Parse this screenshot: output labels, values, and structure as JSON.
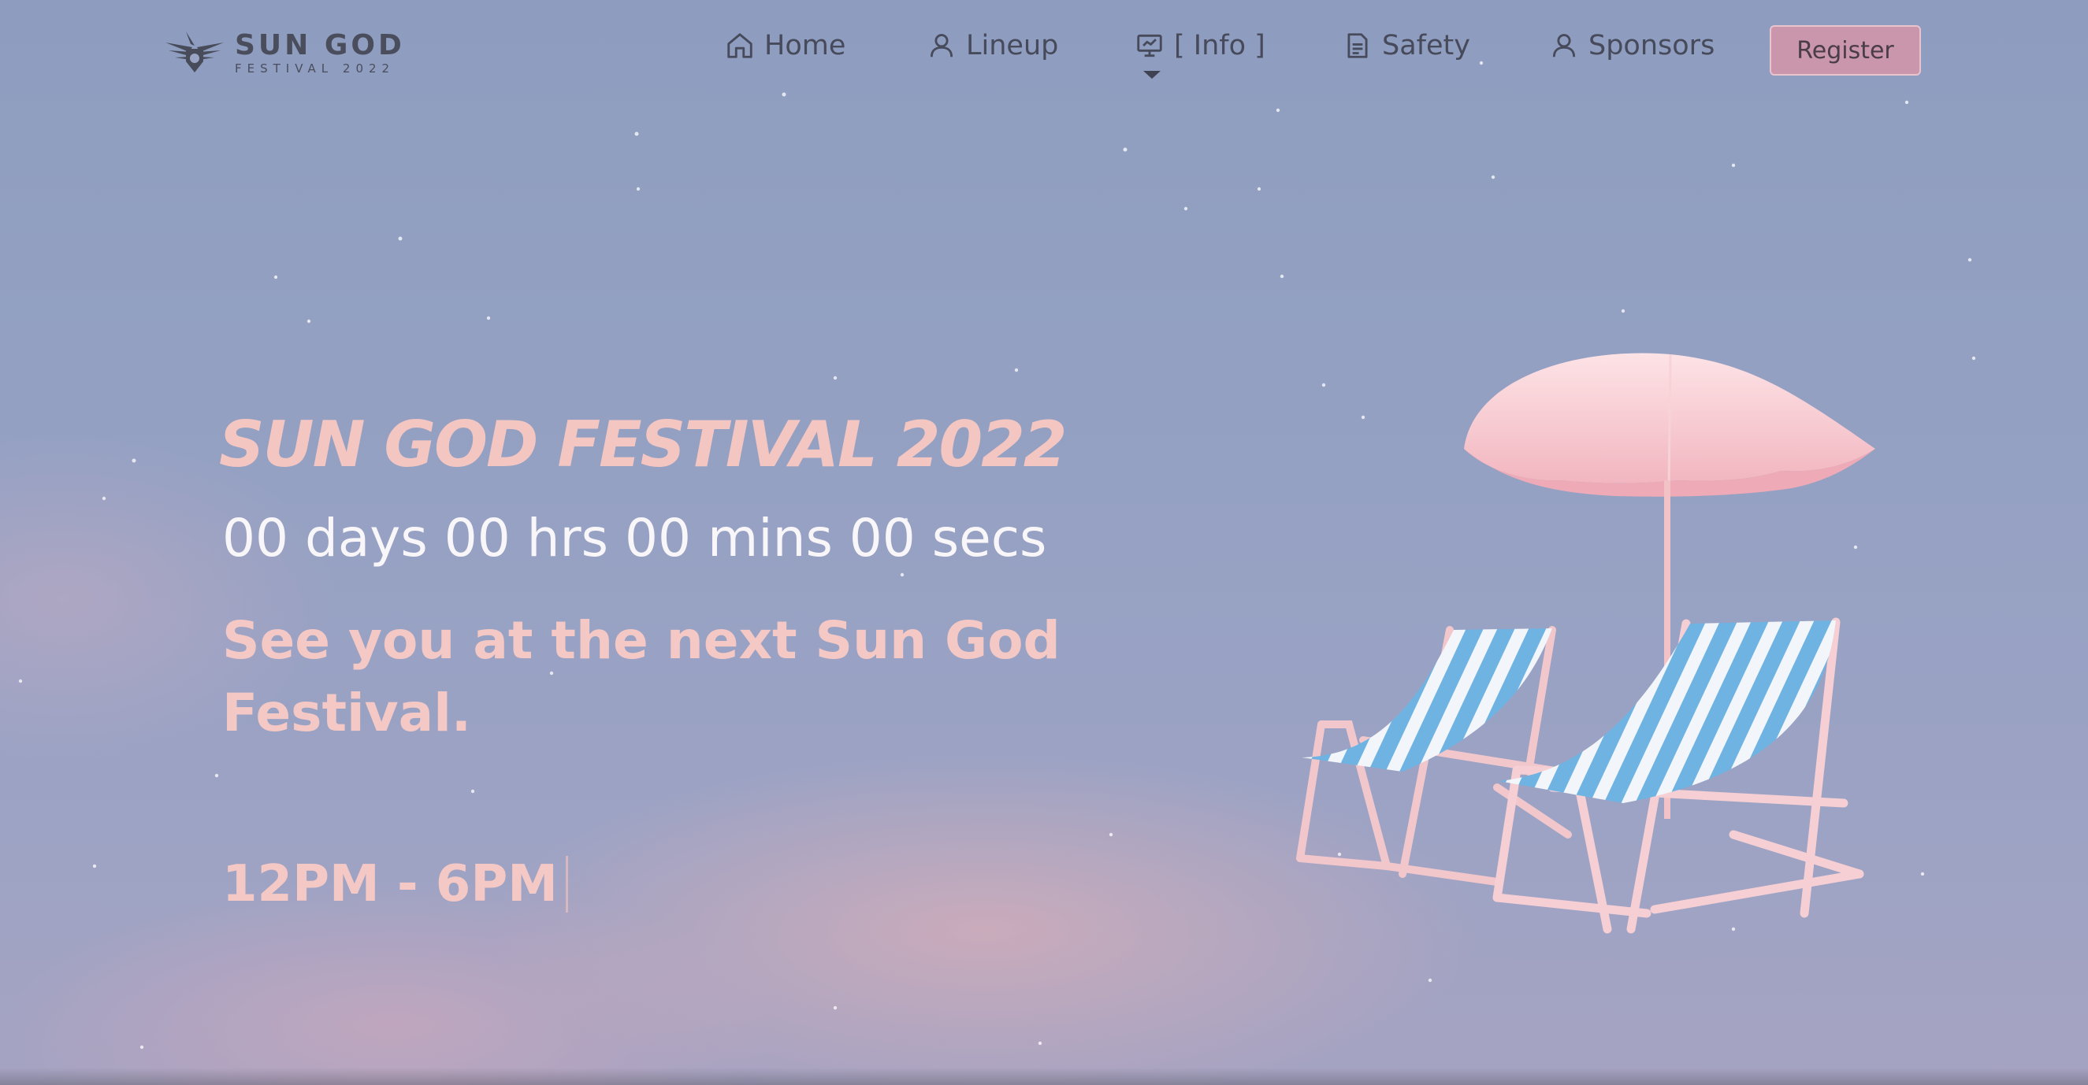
{
  "brand": {
    "title": "SUN GOD",
    "subtitle": "FESTIVAL 2022"
  },
  "nav": {
    "items": [
      {
        "label": "Home",
        "icon": "home-icon"
      },
      {
        "label": "Lineup",
        "icon": "user-icon"
      },
      {
        "label": "[ Info ]",
        "icon": "presentation-icon"
      },
      {
        "label": "Safety",
        "icon": "document-icon"
      },
      {
        "label": "Sponsors",
        "icon": "user-icon"
      }
    ],
    "register_label": "Register"
  },
  "hero": {
    "title": "SUN GOD FESTIVAL 2022",
    "countdown": "00 days 00 hrs 00 mins 00 secs",
    "tagline": "See you at the next Sun God Festival.",
    "time": "12PM - 6PM"
  },
  "colors": {
    "accent_pink": "#f3c6c2",
    "register_bg": "#c996ab",
    "nav_text": "#464a5a",
    "sky": "#8e9dbf"
  }
}
